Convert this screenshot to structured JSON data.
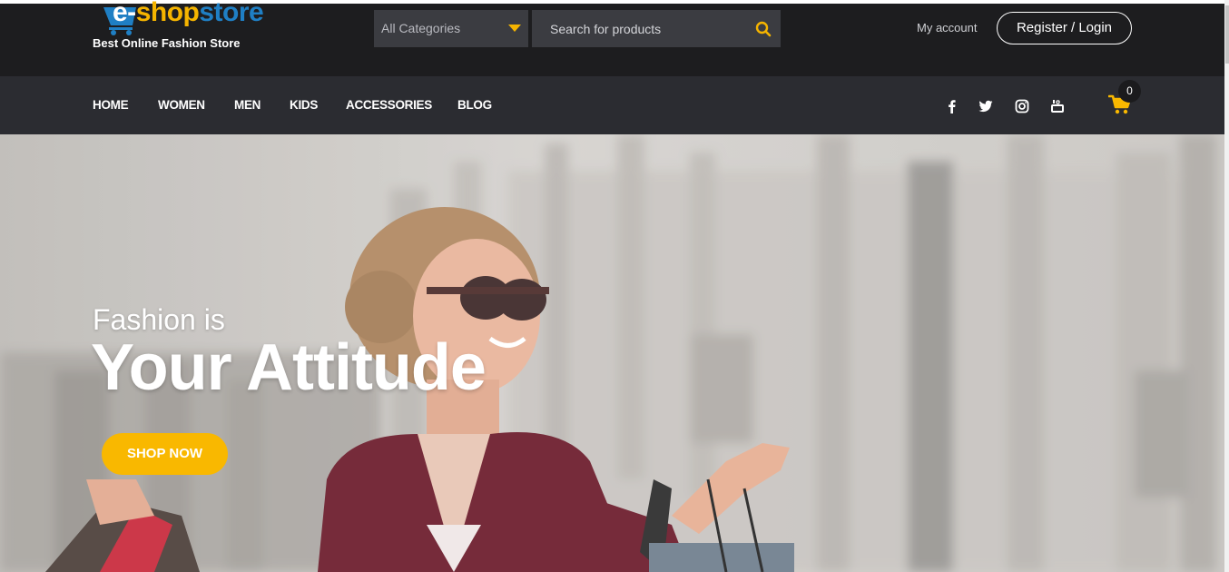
{
  "header": {
    "logo": {
      "e": "e-",
      "shop": "shop",
      "store": "store"
    },
    "tagline": "Best Online Fashion Store",
    "category_select": "All Categories",
    "search_placeholder": "Search for products",
    "my_account": "My account",
    "register_login": "Register / Login"
  },
  "nav": {
    "items": [
      "HOME",
      "WOMEN",
      "MEN",
      "KIDS",
      "ACCESSORIES",
      "BLOG"
    ],
    "social_icons": [
      "facebook-icon",
      "twitter-icon",
      "instagram-icon",
      "youtube-icon"
    ],
    "cart_count": "0"
  },
  "hero": {
    "line1": "Fashion is",
    "line2": "Your Attitude",
    "cta": "SHOP NOW"
  },
  "colors": {
    "header_bg": "#1d1d1f",
    "nav_bg": "#2b2c31",
    "accent": "#f9b800",
    "logo_blue": "#1f7fc4"
  }
}
